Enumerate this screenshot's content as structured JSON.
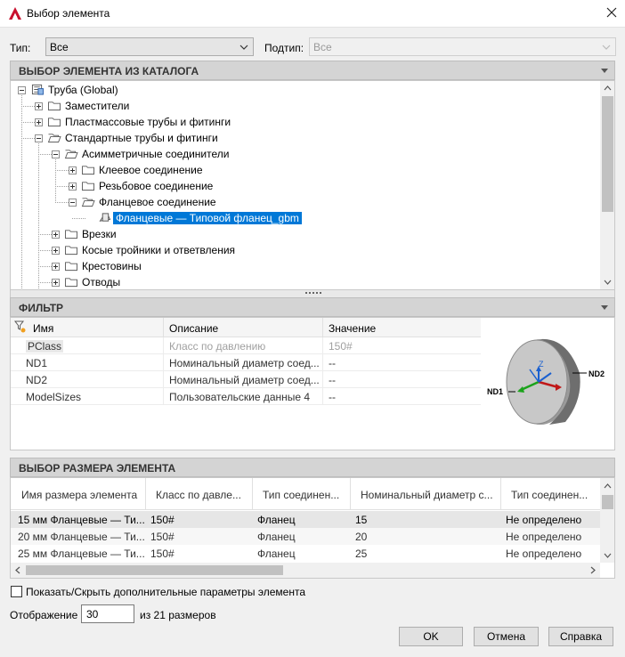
{
  "window": {
    "title": "Выбор элемента"
  },
  "filters": {
    "type_label": "Тип:",
    "type_value": "Все",
    "subtype_label": "Подтип:",
    "subtype_value": "Все"
  },
  "catalog": {
    "header": "ВЫБОР ЭЛЕМЕНТА ИЗ КАТАЛОГА",
    "tree": [
      {
        "label": "Труба (Global)",
        "level": 0,
        "expanded": true,
        "icon": "catalog-icon"
      },
      {
        "label": "Заместители",
        "level": 1,
        "expanded": false,
        "icon": "folder-icon"
      },
      {
        "label": "Пластмассовые трубы и фитинги",
        "level": 1,
        "expanded": false,
        "icon": "folder-icon"
      },
      {
        "label": "Стандартные трубы и фитинги",
        "level": 1,
        "expanded": true,
        "icon": "folder-open-icon"
      },
      {
        "label": "Асимметричные соединители",
        "level": 2,
        "expanded": true,
        "icon": "folder-open-icon"
      },
      {
        "label": "Клеевое соединение",
        "level": 3,
        "expanded": false,
        "icon": "folder-icon"
      },
      {
        "label": "Резьбовое соединение",
        "level": 3,
        "expanded": false,
        "icon": "folder-icon"
      },
      {
        "label": "Фланцевое соединение",
        "level": 3,
        "expanded": true,
        "icon": "folder-open-icon"
      },
      {
        "label": "Фланцевые — Типовой фланец_gbm",
        "level": 4,
        "selected": true,
        "icon": "part-icon"
      },
      {
        "label": "Врезки",
        "level": 2,
        "expanded": false,
        "icon": "folder-icon"
      },
      {
        "label": "Косые тройники и ответвления",
        "level": 2,
        "expanded": false,
        "icon": "folder-icon"
      },
      {
        "label": "Крестовины",
        "level": 2,
        "expanded": false,
        "icon": "folder-icon"
      },
      {
        "label": "Отводы",
        "level": 2,
        "expanded": false,
        "icon": "folder-icon"
      }
    ]
  },
  "filter": {
    "header": "ФИЛЬТР",
    "columns": [
      "Имя",
      "Описание",
      "Значение"
    ],
    "rows": [
      {
        "name": "PClass",
        "desc": "Класс по давлению",
        "value": "150#",
        "disabled": true
      },
      {
        "name": "ND1",
        "desc": "Номинальный диаметр соед...",
        "value": "--"
      },
      {
        "name": "ND2",
        "desc": "Номинальный диаметр соед...",
        "value": "--"
      },
      {
        "name": "ModelSizes",
        "desc": "Пользовательские данные 4",
        "value": "--"
      }
    ],
    "preview_labels": {
      "nd1": "ND1",
      "nd2": "ND2",
      "z": "Z"
    }
  },
  "sizes": {
    "header": "ВЫБОР РАЗМЕРА ЭЛЕМЕНТА",
    "columns": [
      "Имя размера элемента",
      "Класс по давле...",
      "Тип соединен...",
      "Номинальный диаметр с...",
      "Тип соединен..."
    ],
    "rows": [
      [
        "15 мм Фланцевые — Ти...",
        "150#",
        "Фланец",
        "15",
        "Не определено"
      ],
      [
        "20 мм Фланцевые — Ти...",
        "150#",
        "Фланец",
        "20",
        "Не определено"
      ],
      [
        "25 мм Фланцевые — Ти...",
        "150#",
        "Фланец",
        "25",
        "Не определено"
      ]
    ]
  },
  "options": {
    "show_hide_label": "Показать/Скрыть дополнительные параметры элемента",
    "display_label": "Отображение",
    "display_value": "30",
    "of_sizes_label": "из 21 размеров"
  },
  "buttons": {
    "ok": "OK",
    "cancel": "Отмена",
    "help": "Справка"
  },
  "colors": {
    "accent": "#0078d7",
    "app_icon": "#c8102e"
  }
}
